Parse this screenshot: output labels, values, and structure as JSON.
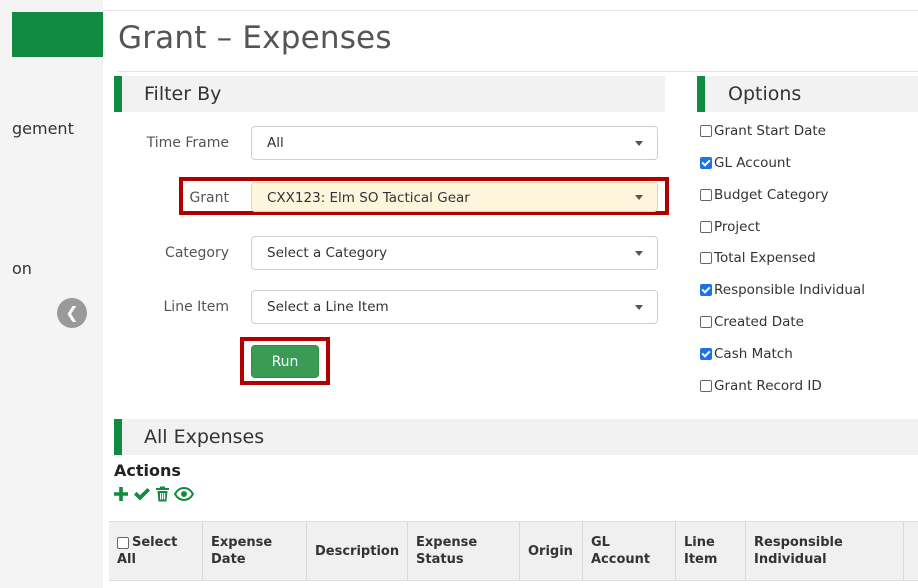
{
  "sidebar": {
    "items": [
      {
        "label": "gement"
      },
      {
        "label": "on"
      }
    ]
  },
  "page": {
    "title": "Grant – Expenses"
  },
  "filter": {
    "title": "Filter By",
    "time_frame": {
      "label": "Time Frame",
      "value": "All"
    },
    "grant": {
      "label": "Grant",
      "value": "CXX123: Elm SO Tactical Gear"
    },
    "category": {
      "label": "Category",
      "placeholder": "Select a Category"
    },
    "line_item": {
      "label": "Line Item",
      "placeholder": "Select a Line Item"
    },
    "run_label": "Run"
  },
  "options": {
    "title": "Options",
    "items": [
      {
        "label": "Grant Start Date",
        "checked": false
      },
      {
        "label": "GL Account",
        "checked": true
      },
      {
        "label": "Budget Category",
        "checked": false
      },
      {
        "label": "Project",
        "checked": false
      },
      {
        "label": "Total Expensed",
        "checked": false
      },
      {
        "label": "Responsible Individual",
        "checked": true
      },
      {
        "label": "Created Date",
        "checked": false
      },
      {
        "label": "Cash Match",
        "checked": true
      },
      {
        "label": "Grant Record ID",
        "checked": false
      }
    ]
  },
  "expenses": {
    "title": "All Expenses",
    "actions_title": "Actions",
    "action_icons": [
      "add-icon",
      "approve-check-icon",
      "delete-trash-icon",
      "view-eye-icon"
    ],
    "columns": [
      "Select All",
      "Expense Date",
      "Description",
      "Expense Status",
      "Origin",
      "GL Account",
      "Line Item",
      "Responsible Individual"
    ]
  },
  "colors": {
    "brand_green": "#118a42",
    "highlight_red": "#b10000",
    "checkbox_blue": "#1a73e8"
  }
}
